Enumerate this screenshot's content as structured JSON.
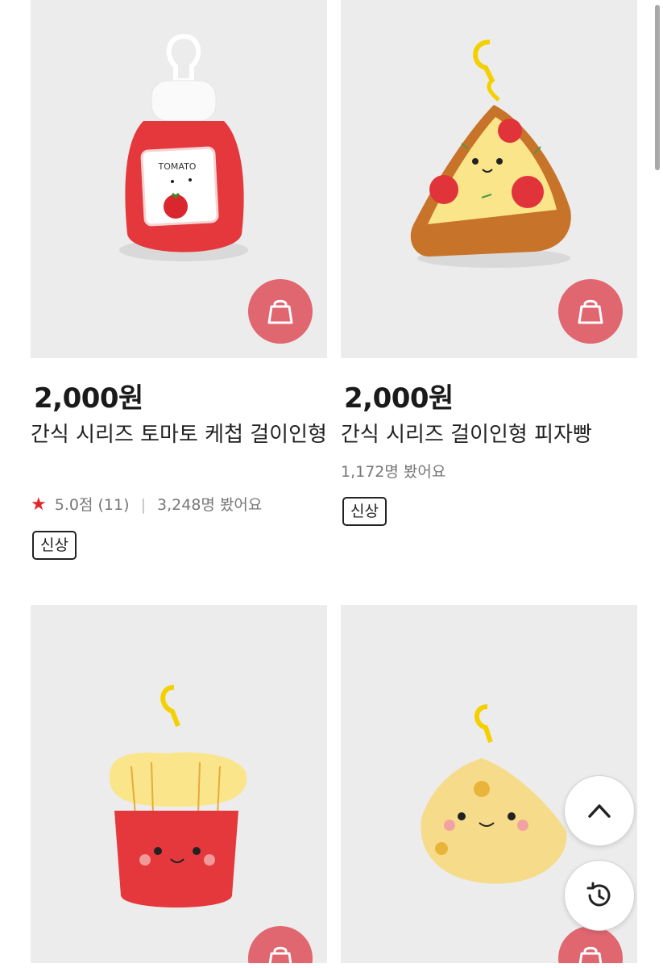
{
  "products": [
    {
      "price": "2,000원",
      "title": "간식 시리즈 토마토 케첩 걸이인형",
      "rating_star": "★",
      "rating": "5.0점 (11)",
      "separator": "|",
      "views": "3,248명 봤어요",
      "badge": "신상",
      "plush": "ketchup-bottle-plush",
      "plush_text": "TOMATO"
    },
    {
      "price": "2,000원",
      "title": "간식 시리즈 걸이인형 피자빵",
      "views": "1,172명 봤어요",
      "badge": "신상",
      "plush": "pizza-slice-plush"
    },
    {
      "plush": "french-fries-plush"
    },
    {
      "plush": "cheese-wedge-plush"
    }
  ],
  "icons": {
    "cart": "shopping-bag-icon",
    "scroll_top": "chevron-up-icon",
    "recent": "history-icon"
  },
  "colors": {
    "cart_button": "#e06670",
    "rating_star": "#e3262a",
    "image_background": "#ececec"
  }
}
